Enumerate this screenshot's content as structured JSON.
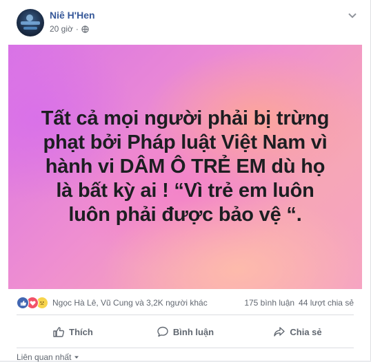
{
  "post": {
    "author": "Niê H'Hen",
    "time": "20 giờ",
    "privacy_icon": "globe-icon",
    "options_icon": "chevron-down-icon"
  },
  "banner": {
    "lines": [
      "Tất cả mọi người phải bị trừng",
      "phạt bởi Pháp luật Việt Nam vì",
      "hành vi DÂM Ô TRẺ EM dù họ",
      "là bất kỳ ai ! “Vì trẻ em luôn",
      "luôn phải được bảo vệ “."
    ]
  },
  "reactions": {
    "types": [
      "like-icon",
      "love-icon",
      "sad-icon"
    ],
    "names": "Ngọc Hà Lê, Vũ Cung và 3,2K người khác",
    "comments": "175 bình luận",
    "shares": "44 lượt chia sẻ"
  },
  "actions": {
    "like": "Thích",
    "comment": "Bình luận",
    "share": "Chia sẻ"
  },
  "related": {
    "label": "Liên quan nhất"
  },
  "colors": {
    "author": "#365899",
    "like": "#4267b2",
    "love": "#f25268",
    "sad": "#f7d44c",
    "muted": "#616770"
  }
}
